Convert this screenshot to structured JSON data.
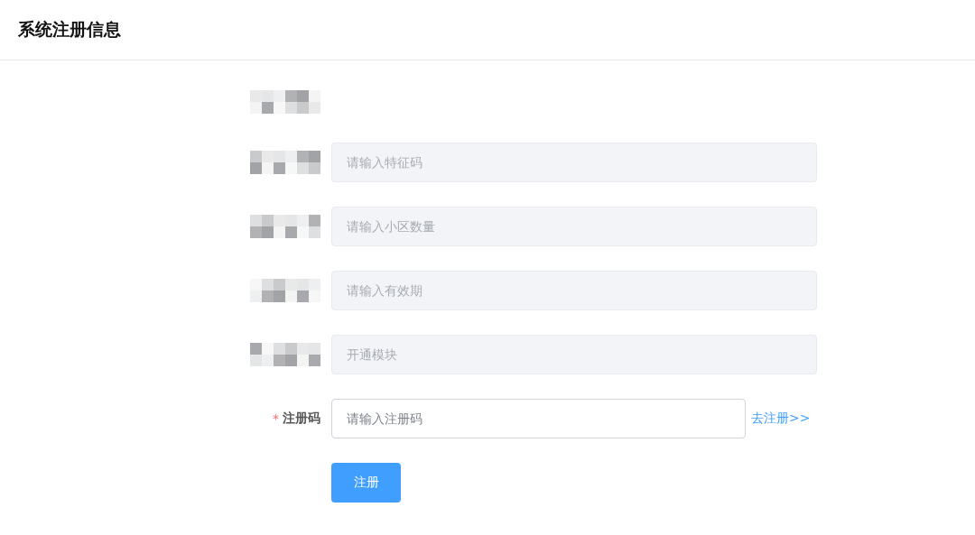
{
  "header": {
    "title": "系统注册信息"
  },
  "form": {
    "rows": [
      {
        "kind": "static",
        "label_pixelated": true
      },
      {
        "kind": "input",
        "label_pixelated": true,
        "placeholder": "请输入特征码",
        "disabled": true
      },
      {
        "kind": "input",
        "label_pixelated": true,
        "placeholder": "请输入小区数量",
        "disabled": true
      },
      {
        "kind": "input",
        "label_pixelated": true,
        "placeholder": "请输入有效期",
        "disabled": true
      },
      {
        "kind": "input",
        "label_pixelated": true,
        "placeholder": "开通模块",
        "disabled": true
      },
      {
        "kind": "input",
        "label_pixelated": false,
        "label": "注册码",
        "required": true,
        "required_mark": "*",
        "placeholder": "请输入注册码",
        "disabled": false,
        "link": "去注册>>"
      }
    ],
    "submit": "注册"
  }
}
